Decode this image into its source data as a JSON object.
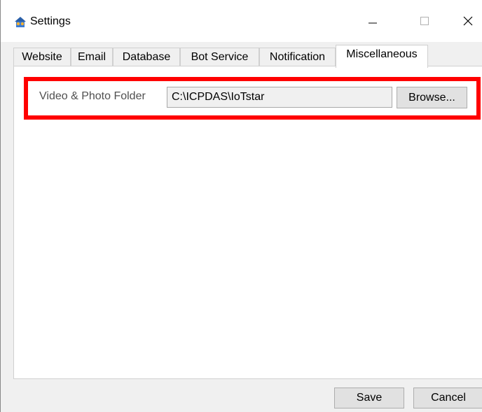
{
  "window": {
    "title": "Settings",
    "icon": "settings-app-icon",
    "controls": {
      "minimize": "minimize-icon",
      "maximize": "maximize-icon",
      "close": "close-icon"
    }
  },
  "tabs": [
    {
      "label": "Website"
    },
    {
      "label": "Email"
    },
    {
      "label": "Database"
    },
    {
      "label": "Bot Service"
    },
    {
      "label": "Notification"
    },
    {
      "label": "Miscellaneous",
      "active": true
    }
  ],
  "misc": {
    "folder_label": "Video & Photo Folder",
    "folder_value": "C:\\ICPDAS\\IoTstar",
    "browse_label": "Browse..."
  },
  "footer": {
    "save_label": "Save",
    "cancel_label": "Cancel"
  },
  "colors": {
    "highlight": "#ff0000",
    "panel": "#ffffff",
    "chrome": "#f0f0f0"
  }
}
